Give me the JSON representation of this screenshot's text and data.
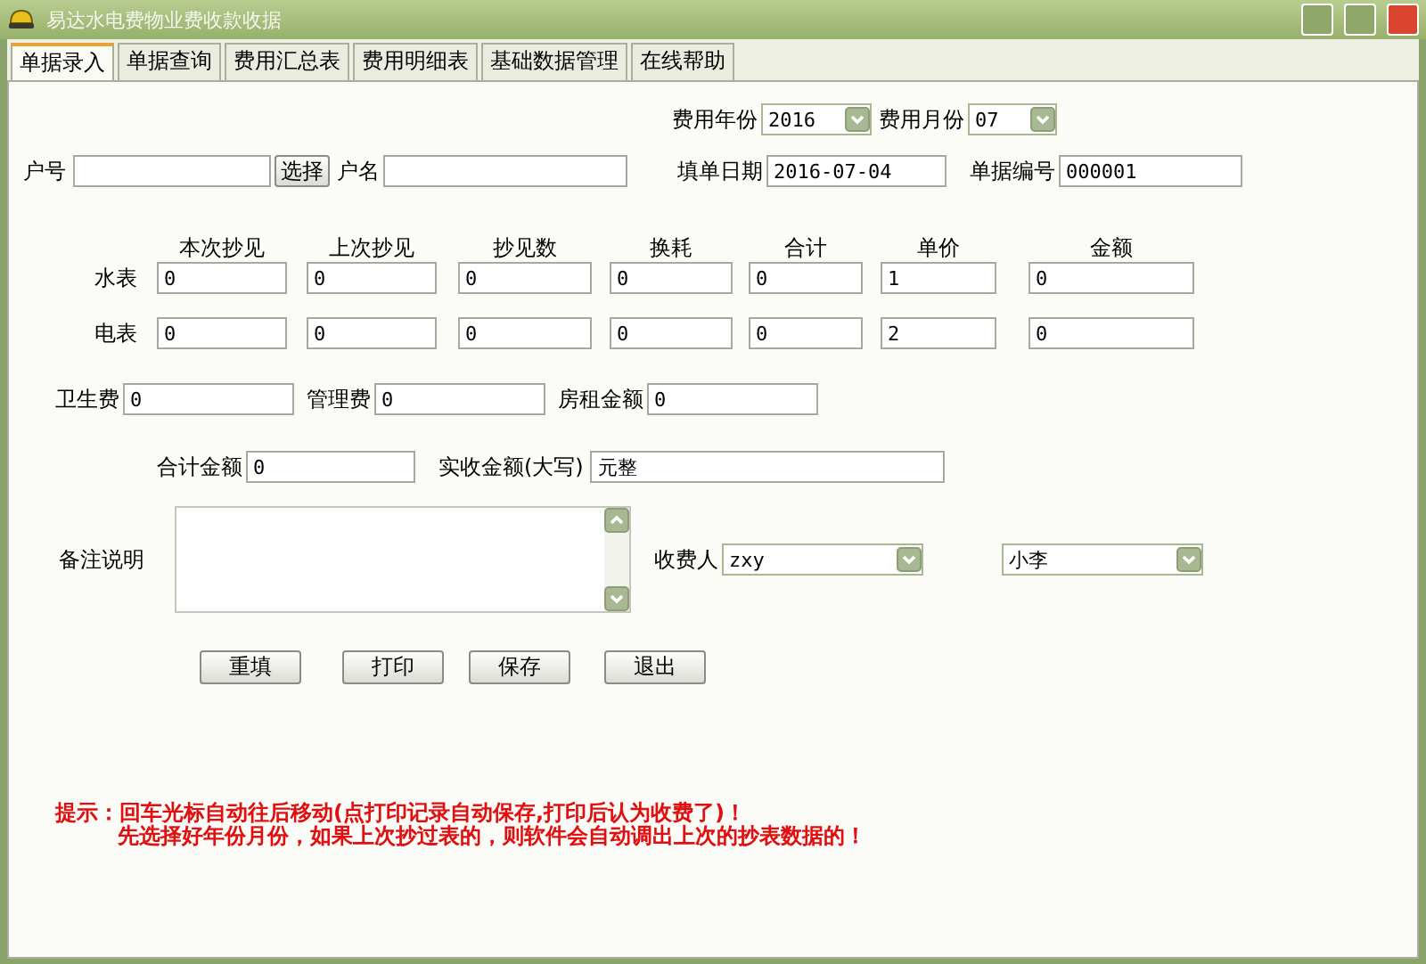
{
  "window": {
    "title": "易达水电费物业费收款收据"
  },
  "tabs": [
    {
      "label": "单据录入",
      "selected": true
    },
    {
      "label": "单据查询",
      "selected": false
    },
    {
      "label": "费用汇总表",
      "selected": false
    },
    {
      "label": "费用明细表",
      "selected": false
    },
    {
      "label": "基础数据管理",
      "selected": false
    },
    {
      "label": "在线帮助",
      "selected": false
    }
  ],
  "period": {
    "year_label": "费用年份",
    "year_value": "2016",
    "month_label": "费用月份",
    "month_value": "07"
  },
  "customer": {
    "number_label": "户号",
    "choose_button": "选择",
    "name_label": "户名"
  },
  "bill": {
    "date_label": "填单日期",
    "date_value": "2016-07-04",
    "number_label": "单据编号",
    "number_value": "000001"
  },
  "meters": {
    "columns": [
      "本次抄见",
      "上次抄见",
      "抄见数",
      "换耗",
      "合计",
      "单价",
      "金额"
    ],
    "rows": [
      {
        "label": "水表",
        "values": [
          "0",
          "0",
          "0",
          "0",
          "0",
          "1",
          "0"
        ]
      },
      {
        "label": "电表",
        "values": [
          "0",
          "0",
          "0",
          "0",
          "0",
          "2",
          "0"
        ]
      }
    ]
  },
  "fees": [
    {
      "label": "卫生费",
      "value": "0"
    },
    {
      "label": "管理费",
      "value": "0"
    },
    {
      "label": "房租金额",
      "value": "0"
    }
  ],
  "totals": {
    "total_label": "合计金额",
    "total_value": "0",
    "words_label": "实收金额(大写)",
    "words_value": "元整"
  },
  "notes": {
    "label": "备注说明"
  },
  "collector": {
    "label": "收费人",
    "value": "zxy",
    "second_value": "小李"
  },
  "buttons": [
    "重填",
    "打印",
    "保存",
    "退出"
  ],
  "tips": [
    "提示：回车光标自动往后移动(点打印记录自动保存,打印后认为收费了)！",
    "先选择好年份月份，如果上次抄过表的，则软件会自动调出上次的抄表数据的！"
  ]
}
